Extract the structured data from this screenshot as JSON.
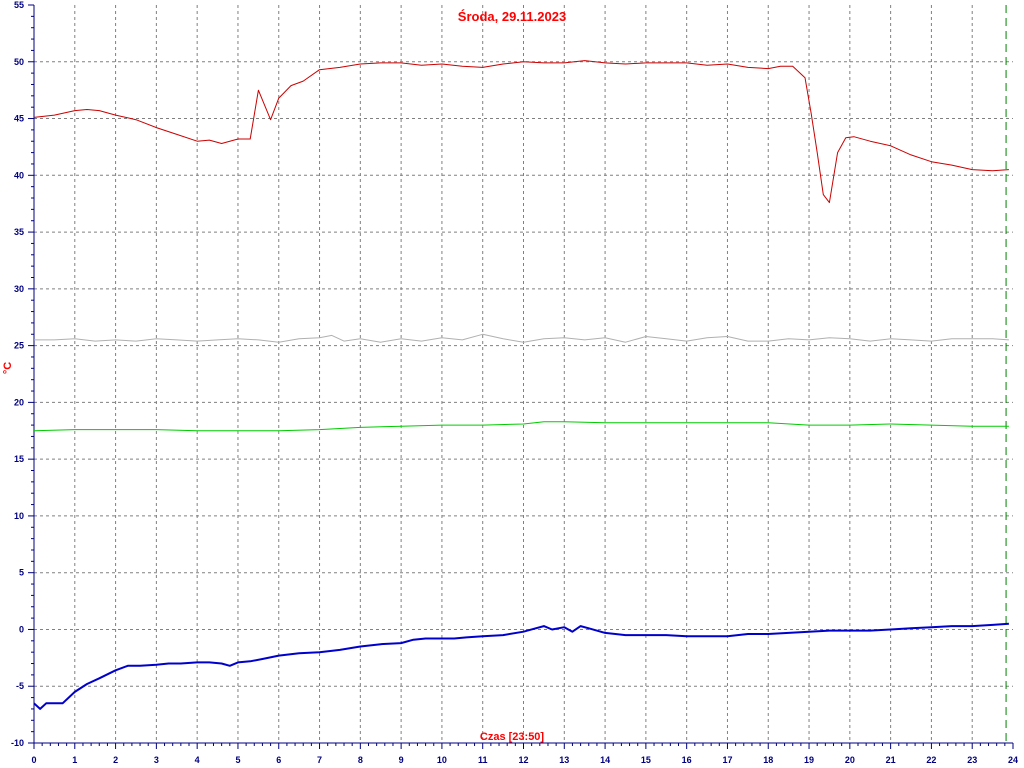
{
  "chart_data": {
    "type": "line",
    "title": "Środa, 29.11.2023",
    "ylabel": "°C",
    "xlabel": "Czas [23:50]",
    "xlim": [
      0,
      24
    ],
    "ylim": [
      -10,
      55
    ],
    "x_ticks": [
      "0",
      "1",
      "2",
      "3",
      "4",
      "5",
      "6",
      "7",
      "8",
      "9",
      "10",
      "11",
      "12",
      "13",
      "14",
      "15",
      "16",
      "17",
      "18",
      "19",
      "20",
      "21",
      "22",
      "23",
      "24"
    ],
    "y_ticks": [
      "-10",
      "-5",
      "0",
      "5",
      "10",
      "15",
      "20",
      "25",
      "30",
      "35",
      "40",
      "45",
      "50",
      "55"
    ],
    "grid": true,
    "current_time_marker": 23.83,
    "colors": {
      "axis": "#000080",
      "grid": "#808080",
      "title": "#ff0000",
      "marker": "#008000"
    },
    "series": [
      {
        "color": "#cc0000",
        "width": 1,
        "x": [
          0,
          0.5,
          1,
          1.3,
          1.6,
          2,
          2.5,
          3,
          3.5,
          4,
          4.3,
          4.6,
          5,
          5.3,
          5.5,
          5.8,
          6,
          6.3,
          6.6,
          7,
          7.5,
          8,
          8.5,
          9,
          9.5,
          10,
          10.5,
          11,
          11.5,
          12,
          12.5,
          13,
          13.5,
          14,
          14.5,
          15,
          15.5,
          16,
          16.5,
          17,
          17.5,
          18,
          18.3,
          18.6,
          18.9,
          19.05,
          19.2,
          19.35,
          19.5,
          19.7,
          19.9,
          20.1,
          20.5,
          21,
          21.5,
          22,
          22.5,
          23,
          23.5,
          23.9
        ],
        "y": [
          45.1,
          45.3,
          45.7,
          45.8,
          45.7,
          45.3,
          44.9,
          44.2,
          43.6,
          43.0,
          43.1,
          42.8,
          43.2,
          43.2,
          47.5,
          44.9,
          46.8,
          47.9,
          48.3,
          49.3,
          49.5,
          49.8,
          49.9,
          49.9,
          49.7,
          49.8,
          49.6,
          49.5,
          49.8,
          50.0,
          49.9,
          49.9,
          50.1,
          49.9,
          49.8,
          49.9,
          49.9,
          49.9,
          49.7,
          49.8,
          49.5,
          49.4,
          49.6,
          49.6,
          48.6,
          45.5,
          42.0,
          38.3,
          37.6,
          42.0,
          43.3,
          43.4,
          43.0,
          42.6,
          41.8,
          41.2,
          40.9,
          40.5,
          40.4,
          40.5
        ]
      },
      {
        "color": "#b0b0b0",
        "width": 1,
        "x": [
          0,
          0.5,
          1,
          1.5,
          2,
          2.5,
          3,
          3.5,
          4,
          4.5,
          5,
          5.5,
          6,
          6.5,
          7,
          7.3,
          7.6,
          8,
          8.5,
          9,
          9.5,
          10,
          10.5,
          11,
          11.5,
          12,
          12.5,
          13,
          13.5,
          14,
          14.5,
          15,
          15.5,
          16,
          16.5,
          17,
          17.5,
          18,
          18.5,
          19,
          19.5,
          20,
          20.5,
          21,
          21.5,
          22,
          22.5,
          23,
          23.5,
          23.9
        ],
        "y": [
          25.5,
          25.5,
          25.6,
          25.4,
          25.5,
          25.4,
          25.6,
          25.5,
          25.4,
          25.5,
          25.6,
          25.5,
          25.3,
          25.6,
          25.7,
          25.9,
          25.4,
          25.6,
          25.3,
          25.6,
          25.4,
          25.7,
          25.5,
          26.0,
          25.6,
          25.3,
          25.6,
          25.7,
          25.5,
          25.7,
          25.3,
          25.8,
          25.6,
          25.4,
          25.7,
          25.8,
          25.4,
          25.4,
          25.6,
          25.5,
          25.7,
          25.6,
          25.4,
          25.6,
          25.5,
          25.4,
          25.6,
          25.6,
          25.6,
          25.5
        ]
      },
      {
        "color": "#00cc00",
        "width": 1,
        "x": [
          0,
          1,
          2,
          3,
          4,
          5,
          6,
          7,
          8,
          9,
          10,
          11,
          12,
          12.5,
          13,
          14,
          15,
          16,
          17,
          18,
          19,
          20,
          21,
          22,
          23,
          23.9
        ],
        "y": [
          17.5,
          17.6,
          17.6,
          17.6,
          17.5,
          17.5,
          17.5,
          17.6,
          17.8,
          17.9,
          18.0,
          18.0,
          18.1,
          18.3,
          18.3,
          18.2,
          18.2,
          18.2,
          18.2,
          18.2,
          18.0,
          18.0,
          18.1,
          18.0,
          17.9,
          17.9
        ]
      },
      {
        "color": "#0000cc",
        "width": 2,
        "x": [
          0,
          0.15,
          0.3,
          0.5,
          0.7,
          1,
          1.3,
          1.6,
          2,
          2.3,
          2.6,
          3,
          3.3,
          3.6,
          4,
          4.3,
          4.6,
          4.8,
          5,
          5.3,
          5.6,
          6,
          6.5,
          7,
          7.5,
          8,
          8.5,
          9,
          9.3,
          9.6,
          10,
          10.3,
          10.6,
          11,
          11.5,
          12,
          12.3,
          12.5,
          12.7,
          13,
          13.2,
          13.4,
          13.6,
          14,
          14.5,
          15,
          15.5,
          16,
          16.5,
          17,
          17.5,
          18,
          18.5,
          19,
          19.5,
          20,
          20.5,
          21,
          21.5,
          22,
          22.5,
          23,
          23.5,
          23.9
        ],
        "y": [
          -6.5,
          -7.0,
          -6.5,
          -6.5,
          -6.5,
          -5.5,
          -4.8,
          -4.3,
          -3.6,
          -3.2,
          -3.2,
          -3.1,
          -3.0,
          -3.0,
          -2.9,
          -2.9,
          -3.0,
          -3.2,
          -2.9,
          -2.8,
          -2.6,
          -2.3,
          -2.1,
          -2.0,
          -1.8,
          -1.5,
          -1.3,
          -1.2,
          -0.9,
          -0.8,
          -0.8,
          -0.8,
          -0.7,
          -0.6,
          -0.5,
          -0.2,
          0.1,
          0.3,
          0.0,
          0.2,
          -0.2,
          0.3,
          0.1,
          -0.3,
          -0.5,
          -0.5,
          -0.5,
          -0.6,
          -0.6,
          -0.6,
          -0.4,
          -0.4,
          -0.3,
          -0.2,
          -0.1,
          -0.1,
          -0.1,
          0.0,
          0.1,
          0.2,
          0.3,
          0.3,
          0.4,
          0.5
        ]
      }
    ]
  }
}
